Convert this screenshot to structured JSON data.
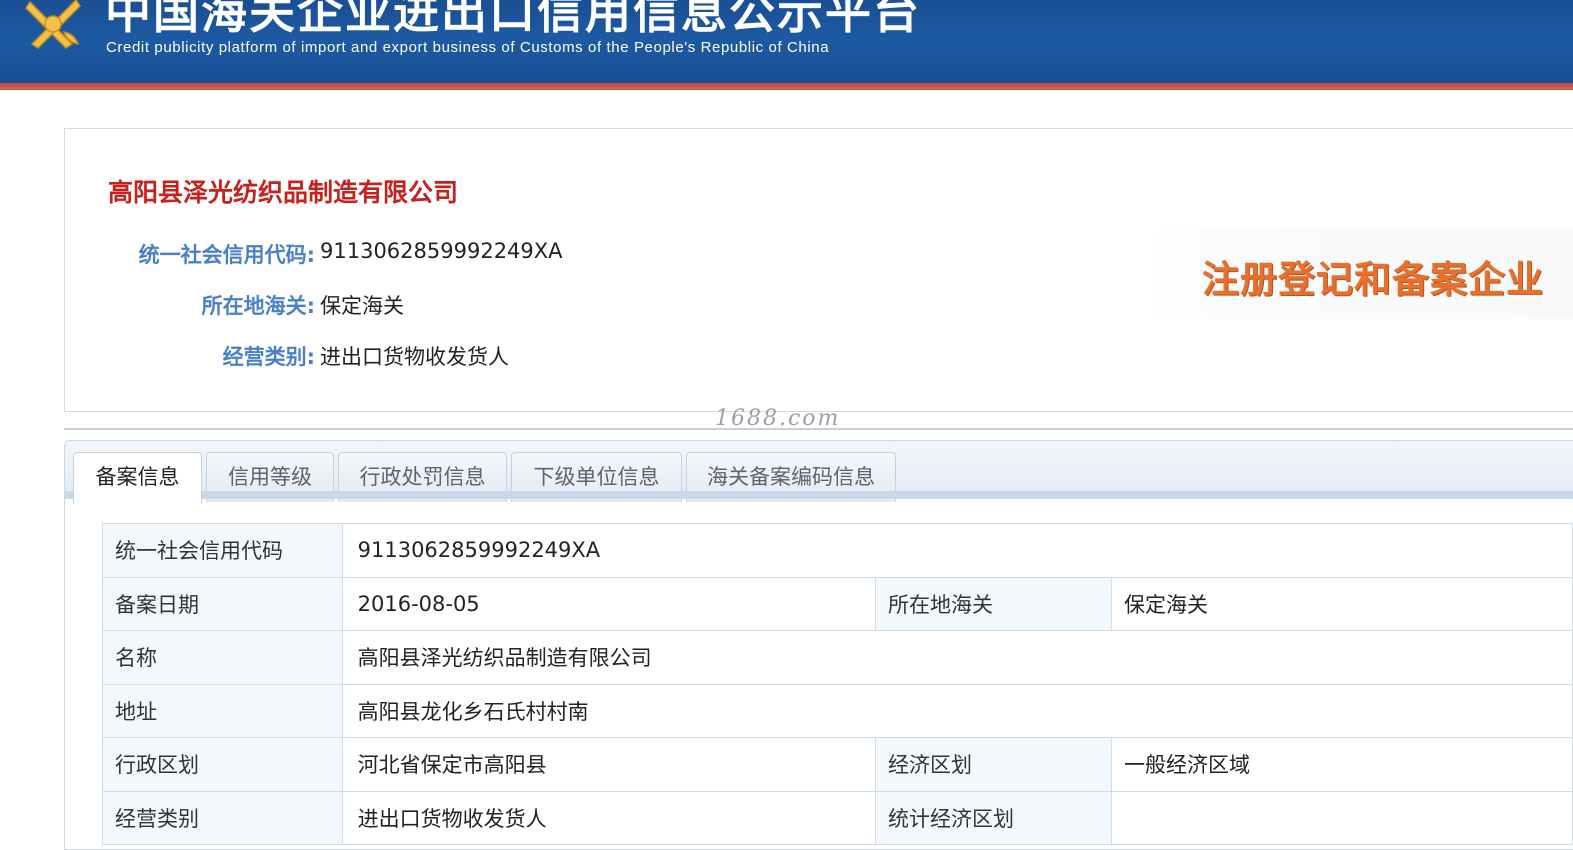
{
  "header": {
    "title": "中国海关企业进出口信用信息公示平台",
    "subtitle": "Credit publicity platform of import and export business of Customs of the People's Republic of China",
    "emblem_icon": "customs-emblem-icon"
  },
  "company": {
    "name": "高阳县泽光纺织品制造有限公司",
    "fields": [
      {
        "label": "统一社会信用代码:",
        "value": "911306285999224​9XA"
      },
      {
        "label": "所在地海关:",
        "value": "保定海关"
      },
      {
        "label": "经营类别:",
        "value": "进出口货物收发货人"
      }
    ],
    "stamp": "注册登记和备案企业"
  },
  "watermark": "1688.com",
  "tabs": [
    {
      "label": "备案信息",
      "active": true
    },
    {
      "label": "信用等级"
    },
    {
      "label": "行政处罚信息"
    },
    {
      "label": "下级单位信息"
    },
    {
      "label": "海关备案编码信息"
    }
  ],
  "table": {
    "credit_code_label": "统一社会信用代码",
    "credit_code": "911306285999224​9XA",
    "record_date_label": "备案日期",
    "record_date": "2016-08-05",
    "customs_label": "所在地海关",
    "customs": "保定海关",
    "name_label": "名称",
    "name": "高阳县泽光纺织品制造有限公司",
    "address_label": "地址",
    "address": "高阳县龙化乡石氏村村南",
    "admin_region_label": "行政区划",
    "admin_region": "河北省保定市高阳县",
    "econ_region_label": "经济区划",
    "econ_region": "一般经济区域",
    "business_type_label": "经营类别",
    "business_type": "进出口货物收发货人",
    "stat_region_label": "统计经济区划",
    "stat_region": ""
  },
  "colors": {
    "banner": "#1d5aa3",
    "banner_stripe": "#c9554f",
    "company_name": "#c8201c",
    "field_label": "#4a80c8",
    "stamp": "#e8702c"
  }
}
